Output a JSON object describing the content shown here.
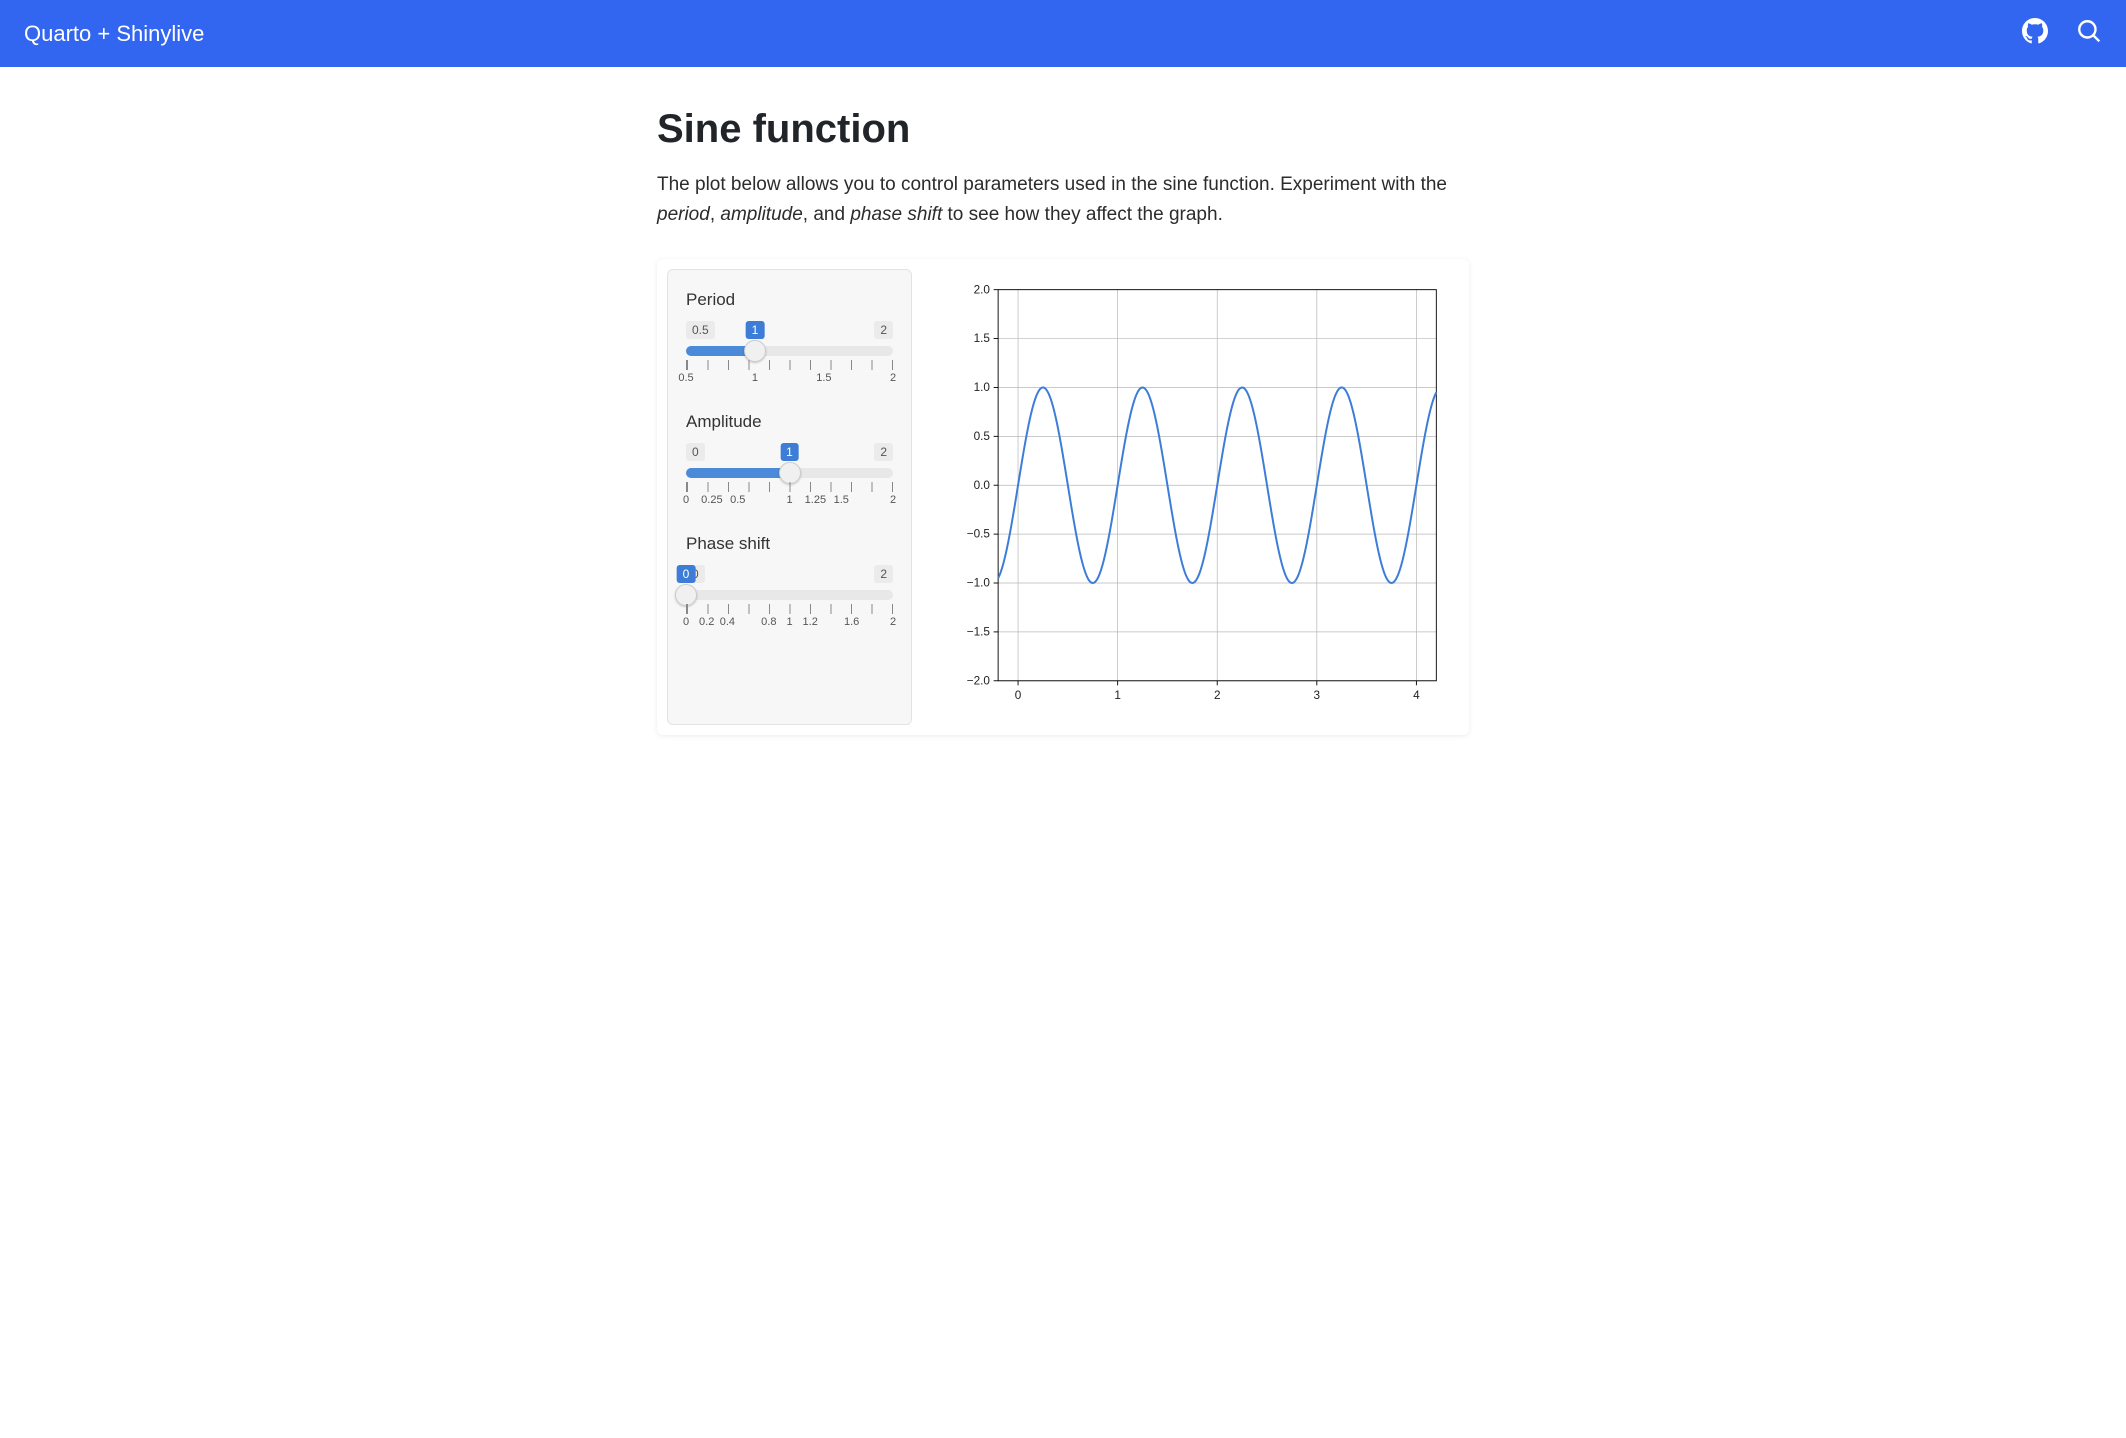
{
  "header": {
    "title": "Quarto + Shinylive"
  },
  "page": {
    "heading": "Sine function",
    "intro_pre": "The plot below allows you to control parameters used in the sine function. Experiment with the ",
    "intro_em1": "period",
    "intro_mid1": ", ",
    "intro_em2": "amplitude",
    "intro_mid2": ", and ",
    "intro_em3": "phase shift",
    "intro_post": " to see how they affect the graph."
  },
  "sliders": {
    "period": {
      "label": "Period",
      "min": "0.5",
      "max": "2",
      "value": "1",
      "fill_pct": 33.3,
      "ticks": [
        {
          "pos": 0,
          "label": "0.5"
        },
        {
          "pos": 33.3,
          "label": "1"
        },
        {
          "pos": 66.6,
          "label": "1.5"
        },
        {
          "pos": 100,
          "label": "2"
        }
      ]
    },
    "amplitude": {
      "label": "Amplitude",
      "min": "0",
      "max": "2",
      "value": "1",
      "fill_pct": 50,
      "ticks": [
        {
          "pos": 0,
          "label": "0"
        },
        {
          "pos": 12.5,
          "label": "0.25"
        },
        {
          "pos": 25,
          "label": "0.5"
        },
        {
          "pos": 50,
          "label": "1"
        },
        {
          "pos": 62.5,
          "label": "1.25"
        },
        {
          "pos": 75,
          "label": "1.5"
        },
        {
          "pos": 100,
          "label": "2"
        }
      ]
    },
    "phase": {
      "label": "Phase shift",
      "min": "0",
      "max": "2",
      "value": "0",
      "fill_pct": 0,
      "ticks": [
        {
          "pos": 0,
          "label": "0"
        },
        {
          "pos": 10,
          "label": "0.2"
        },
        {
          "pos": 20,
          "label": "0.4"
        },
        {
          "pos": 40,
          "label": "0.8"
        },
        {
          "pos": 50,
          "label": "1"
        },
        {
          "pos": 60,
          "label": "1.2"
        },
        {
          "pos": 80,
          "label": "1.6"
        },
        {
          "pos": 100,
          "label": "2"
        }
      ]
    }
  },
  "chart_data": {
    "type": "line",
    "function": "y = amplitude * sin(2*pi/period * (x - phase))",
    "params": {
      "period": 1,
      "amplitude": 1,
      "phase": 0
    },
    "x_range": [
      -0.2,
      4.2
    ],
    "xlim": [
      -0.2,
      4.2
    ],
    "ylim": [
      -2.0,
      2.0
    ],
    "x_ticks": [
      0,
      1,
      2,
      3,
      4
    ],
    "y_ticks": [
      -2.0,
      -1.5,
      -1.0,
      -0.5,
      0.0,
      0.5,
      1.0,
      1.5,
      2.0
    ],
    "y_tick_labels": [
      "−2.0",
      "−1.5",
      "−1.0",
      "−0.5",
      "0.0",
      "0.5",
      "1.0",
      "1.5",
      "2.0"
    ],
    "xlabel": "",
    "ylabel": "",
    "title": "",
    "grid": true
  }
}
